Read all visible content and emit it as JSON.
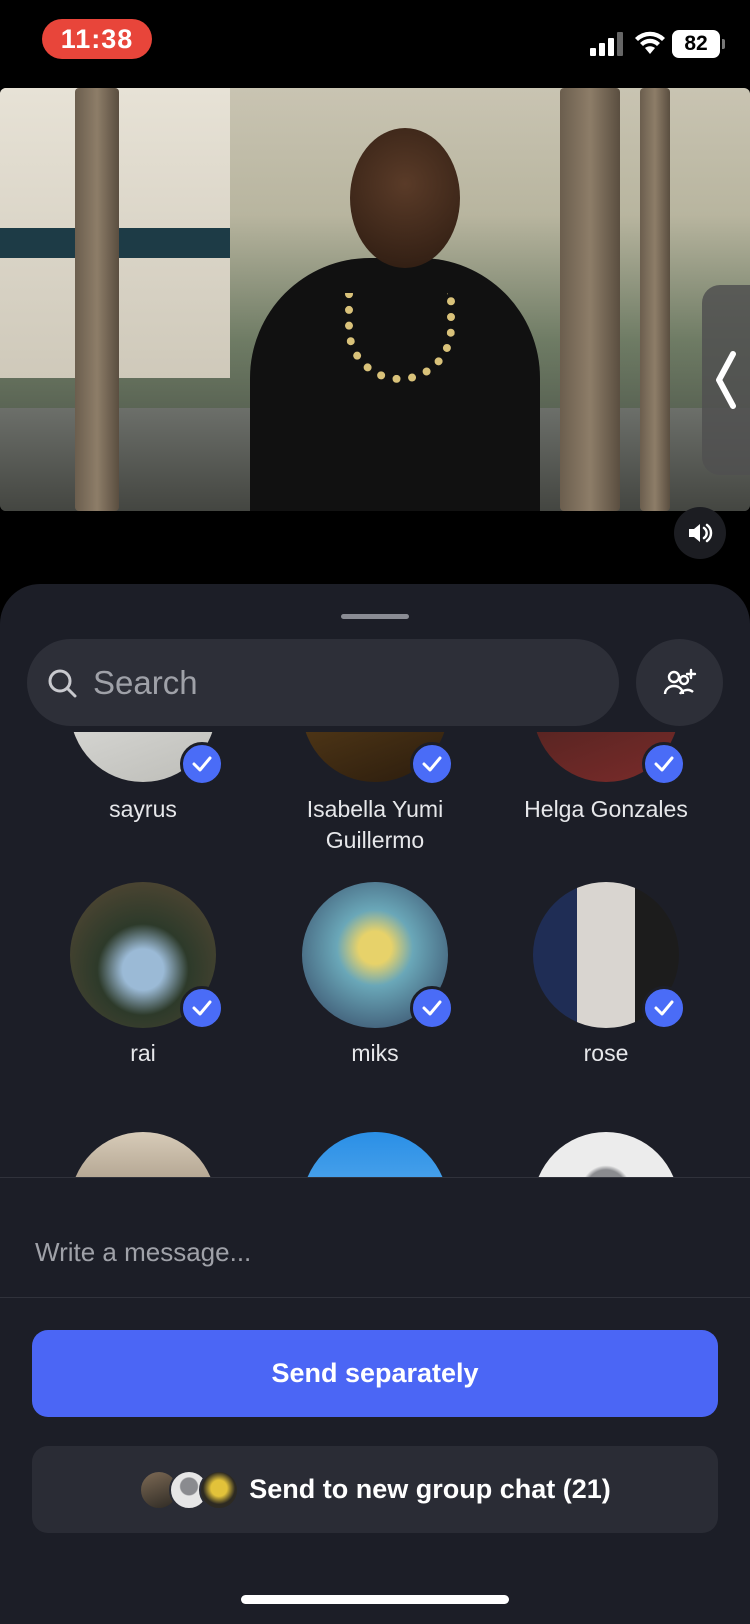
{
  "status_bar": {
    "time": "11:38",
    "battery": "82",
    "accent": "#e8453a"
  },
  "video": {
    "side_handle_icon": "chevron-left-icon",
    "sound_icon": "speaker-icon"
  },
  "share_sheet": {
    "search_placeholder": "Search",
    "add_people_icon": "add-people-icon",
    "contacts": [
      {
        "name": "sayrus",
        "selected": true
      },
      {
        "name": "Isabella Yumi Guillermo",
        "selected": true
      },
      {
        "name": "Helga Gonzales",
        "selected": true
      },
      {
        "name": "rai",
        "selected": true
      },
      {
        "name": "miks",
        "selected": true
      },
      {
        "name": "rose",
        "selected": true
      }
    ],
    "message_placeholder": "Write a message...",
    "send_separately_label": "Send separately",
    "send_group_label": "Send to new group chat (21)",
    "accent": "#4b66f5"
  }
}
